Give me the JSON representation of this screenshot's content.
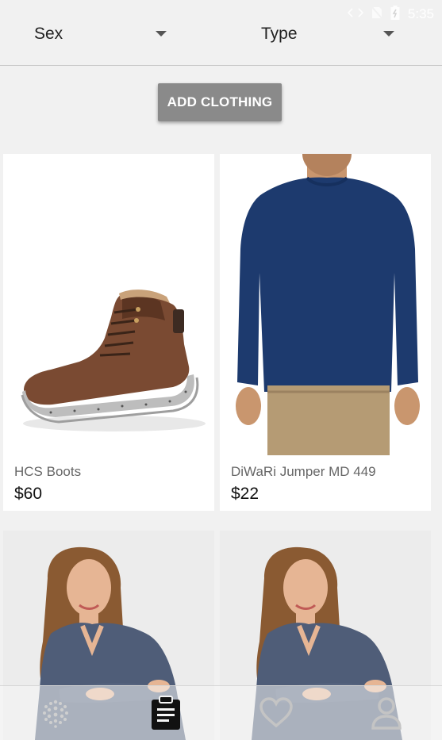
{
  "status_bar": {
    "time": "5:35",
    "icons": [
      "code-icon",
      "no-sim-icon",
      "battery-icon"
    ]
  },
  "filters": {
    "sex_label": "Sex",
    "type_label": "Type"
  },
  "actions": {
    "add_label": "ADD CLOTHING"
  },
  "products": [
    {
      "name": "HCS Boots",
      "price": "$60",
      "image": "brown-boot"
    },
    {
      "name": "DiWaRi Jumper MD 449",
      "price": "$22",
      "image": "navy-jumper"
    },
    {
      "name": "",
      "price": "",
      "image": "woman-grey-top"
    },
    {
      "name": "",
      "price": "",
      "image": "woman-grey-top"
    }
  ],
  "bottom_nav": {
    "items": [
      {
        "icon": "dots-icon",
        "active": false
      },
      {
        "icon": "clipboard-icon",
        "active": true
      },
      {
        "icon": "heart-icon",
        "active": false
      },
      {
        "icon": "person-icon",
        "active": false
      }
    ]
  },
  "colors": {
    "background": "#f1f1f1",
    "button": "#8a8a8a",
    "nav_active": "#111111",
    "nav_inactive": "#bdbdbd"
  }
}
